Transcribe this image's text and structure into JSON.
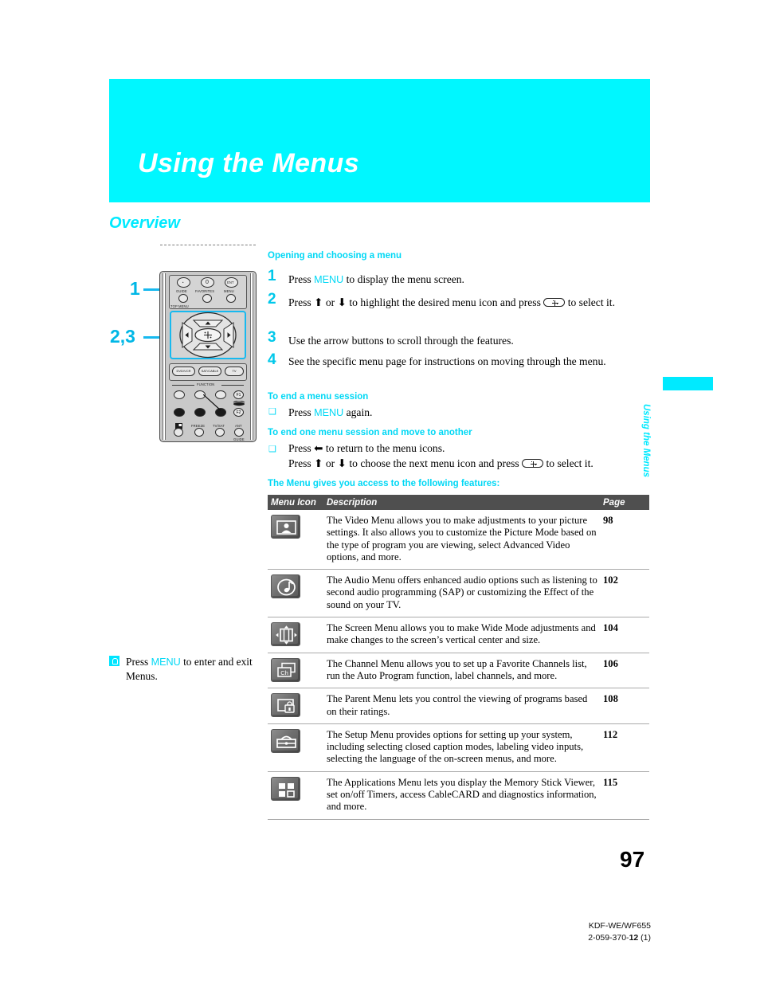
{
  "banner": {
    "title": "Using the Menus"
  },
  "section": {
    "heading": "Overview"
  },
  "callouts": {
    "one": "1",
    "two_three": "2,3"
  },
  "remote": {
    "labels": {
      "guide": "GUIDE",
      "favorites": "FAVORITES",
      "menu": "MENU",
      "top_menu": "TOP MENU",
      "dvd_vcr": "DVD/VCR",
      "sat_cable": "SAT/CABLE",
      "tv": "TV",
      "function": "FUNCTION",
      "f1": "F1",
      "f2": "F2",
      "freeze": "FREEZE",
      "tv_sat": "TV/SAT",
      "ant": "ANT",
      "guide_bottom": "GUIDE",
      "zero": "0",
      "ent": "ENT"
    }
  },
  "instructions": {
    "opening_heading": "Opening and choosing a menu",
    "steps": [
      {
        "num": "1",
        "pre": "Press ",
        "kw": "MENU",
        "post": " to display the menu screen."
      },
      {
        "num": "2",
        "pre": "Press ⬆ or ⬇ to highlight the desired menu icon and press ",
        "post": " to select it."
      },
      {
        "num": "3",
        "pre": "Use the arrow buttons to scroll through the features.",
        "post": ""
      },
      {
        "num": "4",
        "pre": "See the specific menu page for instructions on moving through the menu.",
        "post": ""
      }
    ],
    "end_session_heading": "To end a menu session",
    "end_session_pre": "Press ",
    "end_session_kw": "MENU",
    "end_session_post": " again.",
    "move_heading": "To end one menu session and move to another",
    "move_line1": "Press ⬅ to return to the menu icons.",
    "move_line2_pre": "Press ⬆ or ⬇ to choose the next menu icon and press ",
    "move_line2_post": " to select it.",
    "features_heading": "The Menu gives you access to the following features:"
  },
  "tip": {
    "pre": "Press ",
    "kw": "MENU",
    "post": " to enter and exit Menus."
  },
  "table": {
    "headers": {
      "icon": "Menu Icon",
      "description": "Description",
      "page": "Page"
    },
    "rows": [
      {
        "icon": "video-menu-icon",
        "description": "The Video Menu allows you to make adjustments to your picture settings. It also allows you to customize the Picture Mode based on the type of program you are viewing, select Advanced Video options, and more.",
        "page": "98"
      },
      {
        "icon": "audio-menu-icon",
        "description": "The Audio Menu offers enhanced audio options such as listening to second audio programming (SAP) or customizing the Effect of the sound on your TV.",
        "page": "102"
      },
      {
        "icon": "screen-menu-icon",
        "description": "The Screen Menu allows you to make Wide Mode adjustments and make changes to the screen’s vertical center and size.",
        "page": "104"
      },
      {
        "icon": "channel-menu-icon",
        "description": "The Channel Menu allows you to set up a Favorite Channels list, run the Auto Program function, label channels, and more.",
        "page": "106"
      },
      {
        "icon": "parent-menu-icon",
        "description": "The Parent Menu lets you control the viewing of programs based on their ratings.",
        "page": "108"
      },
      {
        "icon": "setup-menu-icon",
        "description": "The Setup Menu provides options for setting up your system, including selecting closed caption modes, labeling video inputs, selecting the language of the on-screen menus, and more.",
        "page": "112"
      },
      {
        "icon": "applications-menu-icon",
        "description": "The Applications Menu lets you display the Memory Stick Viewer, set on/off Timers, access CableCARD and diagnostics information, and more.",
        "page": "115"
      }
    ]
  },
  "sidebar_tab": {
    "label": "Using the Menus"
  },
  "footer": {
    "page_number": "97",
    "model": "KDF-WE/WF655",
    "doc_prefix": "2-059-370-",
    "doc_bold": "12",
    "doc_suffix": " (1)"
  },
  "colors": {
    "cyan": "#00eaff",
    "banner": "#00f7ff",
    "table_header": "#4f4f4f"
  }
}
